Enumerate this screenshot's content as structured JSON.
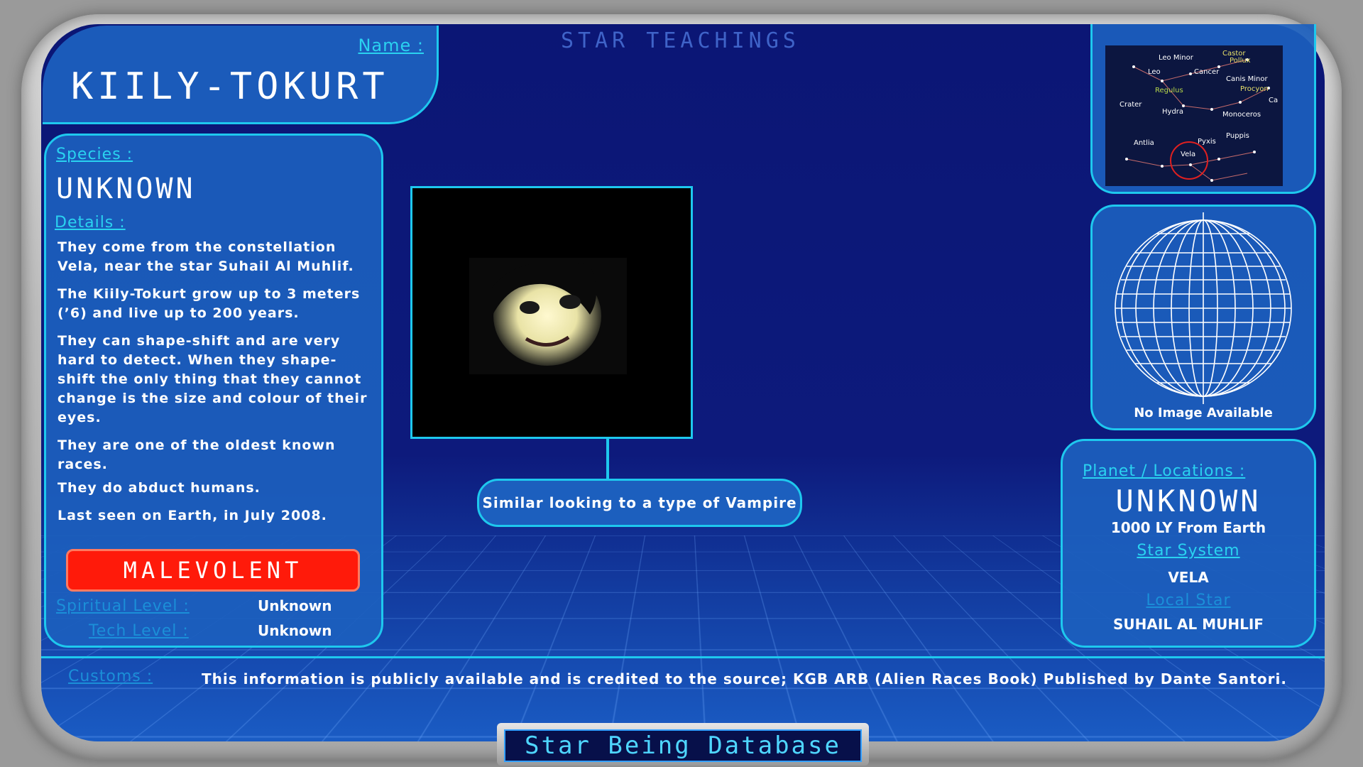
{
  "header": {
    "title": "STAR TEACHINGS"
  },
  "name_card": {
    "label": "Name :",
    "value": "KIILY-TOKURT"
  },
  "species": {
    "label": "Species :",
    "value": "UNKNOWN"
  },
  "details": {
    "label": "Details :",
    "paragraphs": [
      "They come from the constellation Vela, near the star Suhail Al Muhlif.",
      "The Kiily-Tokurt grow up to 3 meters (’6) and live up to 200 years.",
      "They can shape-shift and are very hard to detect. When they shape-shift the only thing that they cannot change is the size and colour of their eyes.",
      "They are one of the oldest known races.",
      "They do abduct humans.",
      "Last seen on Earth, in July 2008."
    ]
  },
  "alignment": {
    "value": "MALEVOLENT",
    "color": "#ff1a0a"
  },
  "levels": {
    "spiritual_label": "Spiritual Level :",
    "spiritual_value": "Unknown",
    "tech_label": "Tech Level :",
    "tech_value": "Unknown"
  },
  "portrait": {
    "caption": "Similar looking to a type of Vampire"
  },
  "constellation_map": {
    "labels": [
      "Leo Minor",
      "Cancer",
      "Castor",
      "Pollux",
      "Leo",
      "Regulus",
      "Canis Minor",
      "Procyon",
      "Crater",
      "Hydra",
      "Monoceros",
      "Antlia",
      "Pyxis",
      "Puppis",
      "Vela",
      "Ca"
    ]
  },
  "globe": {
    "caption": "No Image Available"
  },
  "location": {
    "planet_label": "Planet / Locations :",
    "planet_value": "UNKNOWN",
    "distance": "1000 LY From Earth",
    "system_label": "Star System",
    "system_value": "VELA",
    "local_star_label": "Local Star",
    "local_star_value": "SUHAIL AL MUHLIF"
  },
  "customs": {
    "label": "Customs :",
    "text": "This information is publicly available and is credited to the source; KGB ARB (Alien Races Book) Published by Dante Santori."
  },
  "footer": {
    "title": "Star Being Database"
  },
  "colors": {
    "accent": "#1ec8ee",
    "panel": "#1c5fbe",
    "background": "#0b1675"
  }
}
